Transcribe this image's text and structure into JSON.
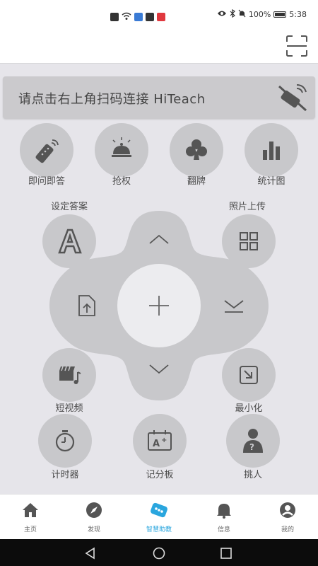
{
  "statusbar": {
    "battery_text": "100%",
    "time": "5:38",
    "icons": [
      "sim-alert-icon",
      "wifi-icon",
      "app-notification-icon",
      "message-icon",
      "battery-saver-icon",
      "eye-icon",
      "bluetooth-icon",
      "mute-icon"
    ]
  },
  "topbar": {
    "scan_icon": "scan-icon"
  },
  "banner": {
    "text": "请点击右上角扫码连接 HiTeach",
    "icon": "disconnected-remote-icon"
  },
  "actions_row1": [
    {
      "label": "即问即答",
      "icon": "remote-control-icon"
    },
    {
      "label": "抢权",
      "icon": "service-bell-icon"
    },
    {
      "label": "翻牌",
      "icon": "clubs-card-icon"
    },
    {
      "label": "统计图",
      "icon": "bar-chart-icon"
    }
  ],
  "left_top": {
    "label": "设定答案",
    "icon": "letter-a-icon"
  },
  "right_top": {
    "label": "照片上传",
    "icon": "grid-icon"
  },
  "dpad": {
    "up_icon": "chevron-up-icon",
    "down_icon": "chevron-down-icon",
    "left_icon": "file-upload-icon",
    "right_icon": "minimize-down-icon",
    "center_icon": "plus-icon"
  },
  "left_bottom": {
    "label": "短视频",
    "icon": "video-music-icon"
  },
  "right_bottom": {
    "label": "最小化",
    "icon": "minimize-window-icon"
  },
  "actions_row3": [
    {
      "label": "计时器",
      "icon": "stopwatch-icon"
    },
    {
      "label": "记分板",
      "icon": "scoreboard-icon"
    },
    {
      "label": "挑人",
      "icon": "pick-person-icon"
    }
  ],
  "tabs": [
    {
      "label": "主页",
      "icon": "home-icon",
      "active": false
    },
    {
      "label": "发现",
      "icon": "compass-icon",
      "active": false
    },
    {
      "label": "智慧助教",
      "icon": "smart-assistant-icon",
      "active": true
    },
    {
      "label": "信息",
      "icon": "bell-icon",
      "active": false
    },
    {
      "label": "我的",
      "icon": "user-icon",
      "active": false
    }
  ],
  "accent_color": "#2aa6de",
  "navbar": {
    "back_icon": "back-triangle-icon",
    "home_icon": "home-circle-icon",
    "recents_icon": "recents-square-icon"
  }
}
